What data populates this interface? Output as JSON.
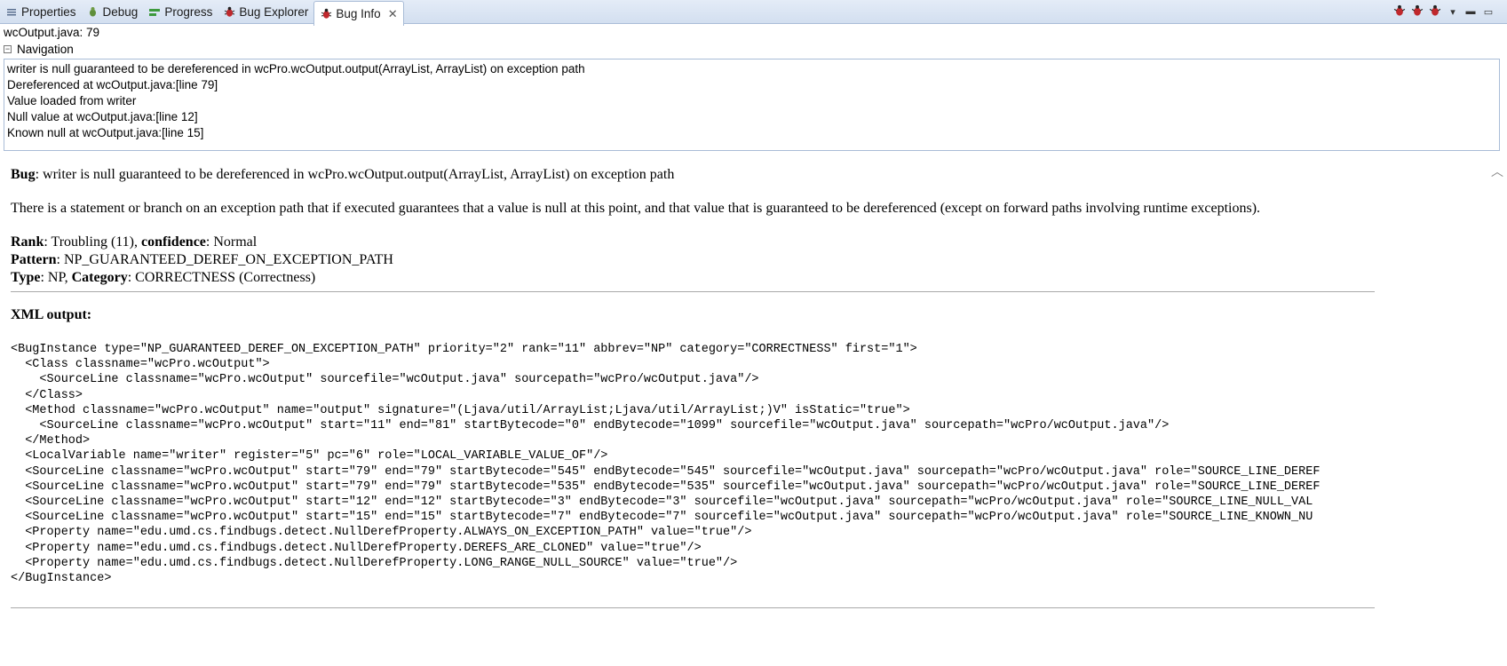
{
  "tabs": [
    {
      "label": "Properties",
      "icon": "properties-icon"
    },
    {
      "label": "Debug",
      "icon": "debug-icon"
    },
    {
      "label": "Progress",
      "icon": "progress-icon"
    },
    {
      "label": "Bug Explorer",
      "icon": "bug-icon"
    },
    {
      "label": "Bug Info",
      "icon": "bug-icon",
      "active": true
    }
  ],
  "file_location": "wcOutput.java: 79",
  "navigation": {
    "title": "Navigation",
    "items": [
      "writer is null guaranteed to be dereferenced in wcPro.wcOutput.output(ArrayList, ArrayList) on exception path",
      "Dereferenced at wcOutput.java:[line 79]",
      "Value loaded from writer",
      "Null value at wcOutput.java:[line 12]",
      "Known null at wcOutput.java:[line 15]"
    ]
  },
  "bug": {
    "bug_label": "Bug",
    "bug_text": ": writer is null guaranteed to be dereferenced in wcPro.wcOutput.output(ArrayList, ArrayList) on exception path",
    "description": "There is a statement or branch on an exception path that if executed guarantees that a value is null at this point, and that value that is guaranteed to be dereferenced (except on forward paths involving runtime exceptions).",
    "rank_label": "Rank",
    "rank_value": ": Troubling (11), ",
    "confidence_label": "confidence",
    "confidence_value": ": Normal",
    "pattern_label": "Pattern",
    "pattern_value": ": NP_GUARANTEED_DEREF_ON_EXCEPTION_PATH",
    "type_label": "Type",
    "type_value": ": NP, ",
    "category_label": "Category",
    "category_value": ": CORRECTNESS (Correctness)"
  },
  "xml": {
    "heading": "XML output:",
    "lines": [
      "<BugInstance type=\"NP_GUARANTEED_DEREF_ON_EXCEPTION_PATH\" priority=\"2\" rank=\"11\" abbrev=\"NP\" category=\"CORRECTNESS\" first=\"1\">",
      "  <Class classname=\"wcPro.wcOutput\">",
      "    <SourceLine classname=\"wcPro.wcOutput\" sourcefile=\"wcOutput.java\" sourcepath=\"wcPro/wcOutput.java\"/>",
      "  </Class>",
      "  <Method classname=\"wcPro.wcOutput\" name=\"output\" signature=\"(Ljava/util/ArrayList;Ljava/util/ArrayList;)V\" isStatic=\"true\">",
      "    <SourceLine classname=\"wcPro.wcOutput\" start=\"11\" end=\"81\" startBytecode=\"0\" endBytecode=\"1099\" sourcefile=\"wcOutput.java\" sourcepath=\"wcPro/wcOutput.java\"/>",
      "  </Method>",
      "  <LocalVariable name=\"writer\" register=\"5\" pc=\"6\" role=\"LOCAL_VARIABLE_VALUE_OF\"/>",
      "  <SourceLine classname=\"wcPro.wcOutput\" start=\"79\" end=\"79\" startBytecode=\"545\" endBytecode=\"545\" sourcefile=\"wcOutput.java\" sourcepath=\"wcPro/wcOutput.java\" role=\"SOURCE_LINE_DEREF",
      "  <SourceLine classname=\"wcPro.wcOutput\" start=\"79\" end=\"79\" startBytecode=\"535\" endBytecode=\"535\" sourcefile=\"wcOutput.java\" sourcepath=\"wcPro/wcOutput.java\" role=\"SOURCE_LINE_DEREF",
      "  <SourceLine classname=\"wcPro.wcOutput\" start=\"12\" end=\"12\" startBytecode=\"3\" endBytecode=\"3\" sourcefile=\"wcOutput.java\" sourcepath=\"wcPro/wcOutput.java\" role=\"SOURCE_LINE_NULL_VAL",
      "  <SourceLine classname=\"wcPro.wcOutput\" start=\"15\" end=\"15\" startBytecode=\"7\" endBytecode=\"7\" sourcefile=\"wcOutput.java\" sourcepath=\"wcPro/wcOutput.java\" role=\"SOURCE_LINE_KNOWN_NU",
      "  <Property name=\"edu.umd.cs.findbugs.detect.NullDerefProperty.ALWAYS_ON_EXCEPTION_PATH\" value=\"true\"/>",
      "  <Property name=\"edu.umd.cs.findbugs.detect.NullDerefProperty.DEREFS_ARE_CLONED\" value=\"true\"/>",
      "  <Property name=\"edu.umd.cs.findbugs.detect.NullDerefProperty.LONG_RANGE_NULL_SOURCE\" value=\"true\"/>",
      "</BugInstance>"
    ]
  },
  "colors": {
    "bug_red": "#c0282d",
    "tab_border": "#a9bcd7"
  }
}
